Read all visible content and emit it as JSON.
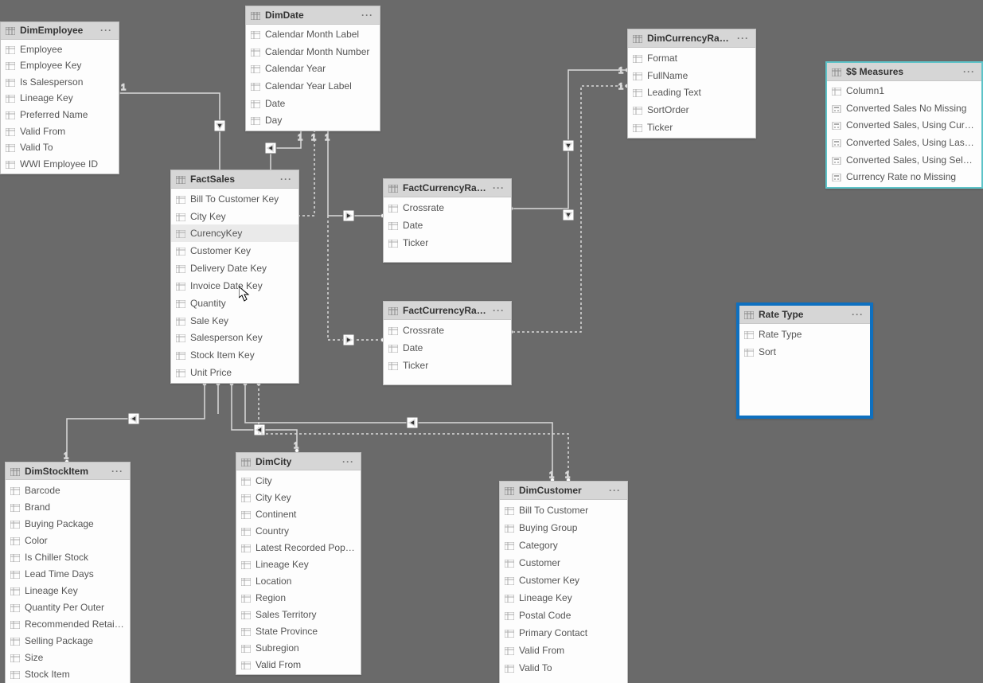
{
  "tables": {
    "dimEmployee": {
      "title": "DimEmployee",
      "fields": [
        "Employee",
        "Employee Key",
        "Is Salesperson",
        "Lineage Key",
        "Preferred Name",
        "Valid From",
        "Valid To",
        "WWI Employee ID"
      ]
    },
    "dimDate": {
      "title": "DimDate",
      "fields": [
        "Calendar Month Label",
        "Calendar Month Number",
        "Calendar Year",
        "Calendar Year Label",
        "Date",
        "Day"
      ]
    },
    "dimCurrencyRates": {
      "title": "DimCurrencyRates",
      "fields": [
        "Format",
        "FullName",
        "Leading Text",
        "SortOrder",
        "Ticker"
      ]
    },
    "measures": {
      "title": "$$ Measures",
      "fields": [
        "Column1",
        "Converted Sales No Missing",
        "Converted Sales, Using Current ...",
        "Converted Sales, Using Last Rep...",
        "Converted Sales, Using Selected...",
        "Currency Rate no Missing"
      ]
    },
    "factSales": {
      "title": "FactSales",
      "fields": [
        "Bill To Customer Key",
        "City Key",
        "CurencyKey",
        "Customer Key",
        "Delivery Date Key",
        "Invoice Date Key",
        "Quantity",
        "Sale Key",
        "Salesperson Key",
        "Stock Item Key",
        "Unit Price"
      ]
    },
    "factCurrencyRates": {
      "title": "FactCurrencyRates",
      "fields": [
        "Crossrate",
        "Date",
        "Ticker"
      ]
    },
    "factCurrencyRatesB": {
      "title": "FactCurrencyRates...",
      "fields": [
        "Crossrate",
        "Date",
        "Ticker"
      ]
    },
    "rateType": {
      "title": "Rate Type",
      "fields": [
        "Rate Type",
        "Sort"
      ]
    },
    "dimStockItem": {
      "title": "DimStockItem",
      "fields": [
        "Barcode",
        "Brand",
        "Buying Package",
        "Color",
        "Is Chiller Stock",
        "Lead Time Days",
        "Lineage Key",
        "Quantity Per Outer",
        "Recommended Retail Price",
        "Selling Package",
        "Size",
        "Stock Item"
      ]
    },
    "dimCity": {
      "title": "DimCity",
      "fields": [
        "City",
        "City Key",
        "Continent",
        "Country",
        "Latest Recorded Populati...",
        "Lineage Key",
        "Location",
        "Region",
        "Sales Territory",
        "State Province",
        "Subregion",
        "Valid From"
      ]
    },
    "dimCustomer": {
      "title": "DimCustomer",
      "fields": [
        "Bill To Customer",
        "Buying Group",
        "Category",
        "Customer",
        "Customer Key",
        "Lineage Key",
        "Postal Code",
        "Primary Contact",
        "Valid From",
        "Valid To"
      ]
    }
  },
  "relLabels": {
    "one": "1",
    "many": "*"
  },
  "fieldIconTypes": {
    "measures": [
      "col",
      "calc",
      "calc",
      "calc",
      "calc",
      "calc"
    ]
  }
}
